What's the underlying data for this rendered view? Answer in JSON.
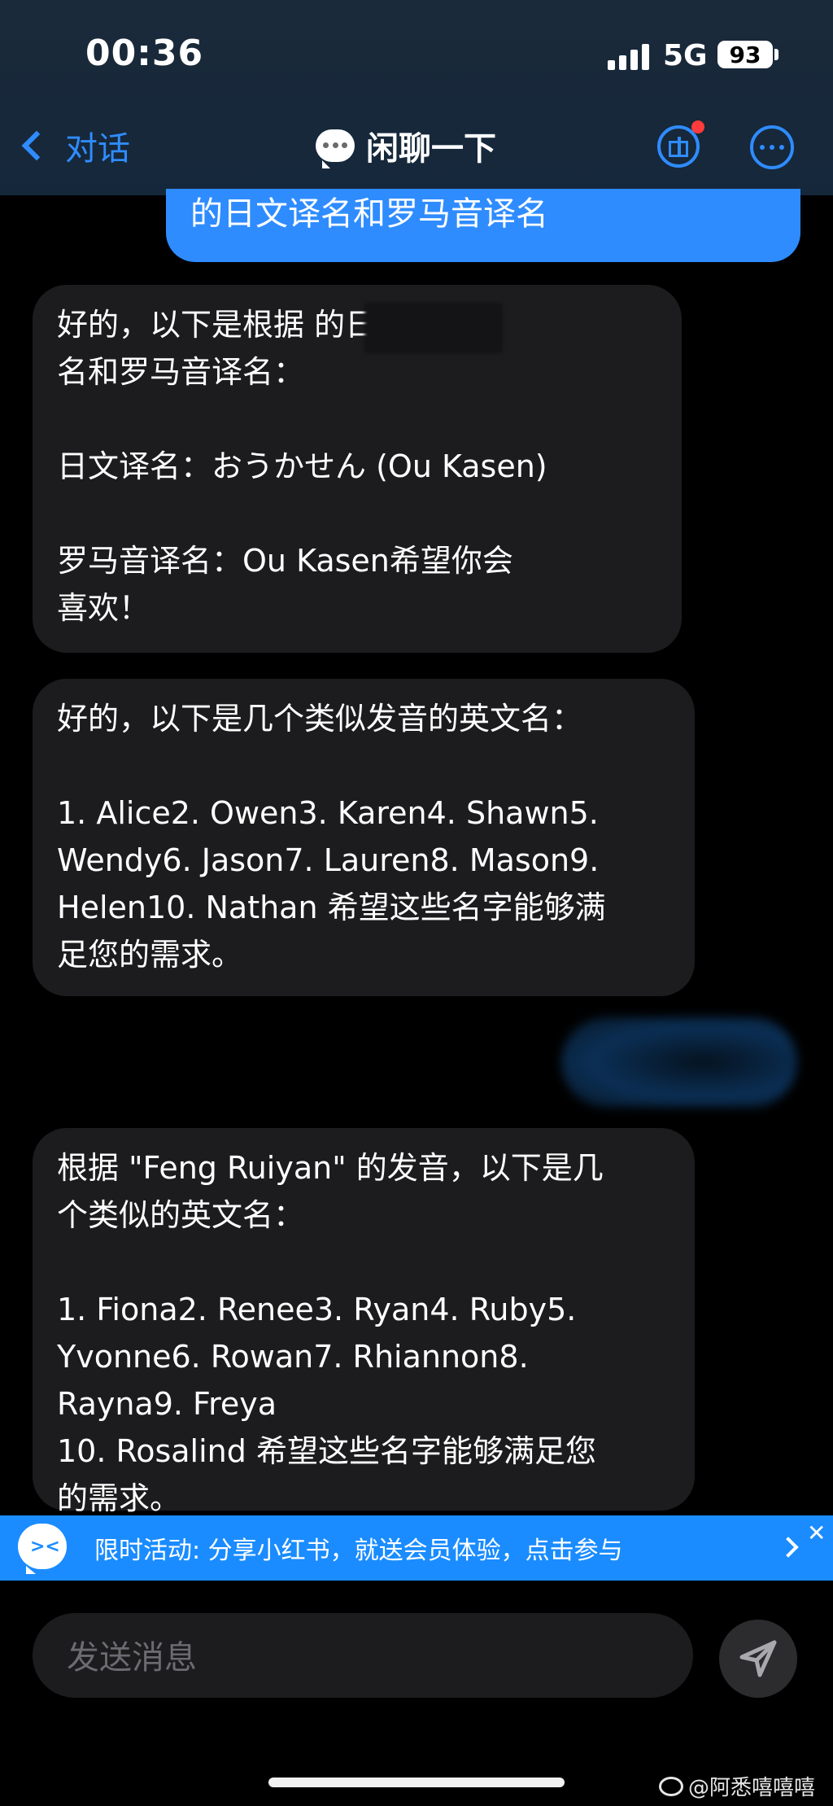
{
  "status_bar": {
    "time": "00:36",
    "network": "5G",
    "battery": "93"
  },
  "nav": {
    "back_label": "对话",
    "title": "闲聊一下"
  },
  "messages": [
    {
      "role": "user",
      "text": "的日文译名和罗马音译名"
    },
    {
      "role": "assistant",
      "text": "好的，以下是根据                的日文译\n名和罗马音译名：\n\n日文译名：おうかせん (Ou Kasen)\n\n罗马音译名：Ou Kasen希望你会\n喜欢！"
    },
    {
      "role": "assistant",
      "text": "好的，以下是几个类似发音的英文名：\n\n1. Alice2. Owen3. Karen4. Shawn5.\nWendy6. Jason7. Lauren8. Mason9.\nHelen10. Nathan 希望这些名字能够满\n足您的需求。"
    },
    {
      "role": "assistant",
      "text": "根据 \"Feng Ruiyan\" 的发音，以下是几\n个类似的英文名：\n\n1. Fiona2. Renee3. Ryan4. Ruby5.\nYvonne6. Rowan7. Rhiannon8.\nRayna9. Freya\n10. Rosalind 希望这些名字能够满足您\n的需求。"
    }
  ],
  "promo": {
    "text": "限时活动: 分享小红书，就送会员体验，点击参与",
    "face": "><",
    "close": "✕"
  },
  "composer": {
    "placeholder": "发送消息"
  },
  "watermark": "@阿悉嘻嘻嘻"
}
